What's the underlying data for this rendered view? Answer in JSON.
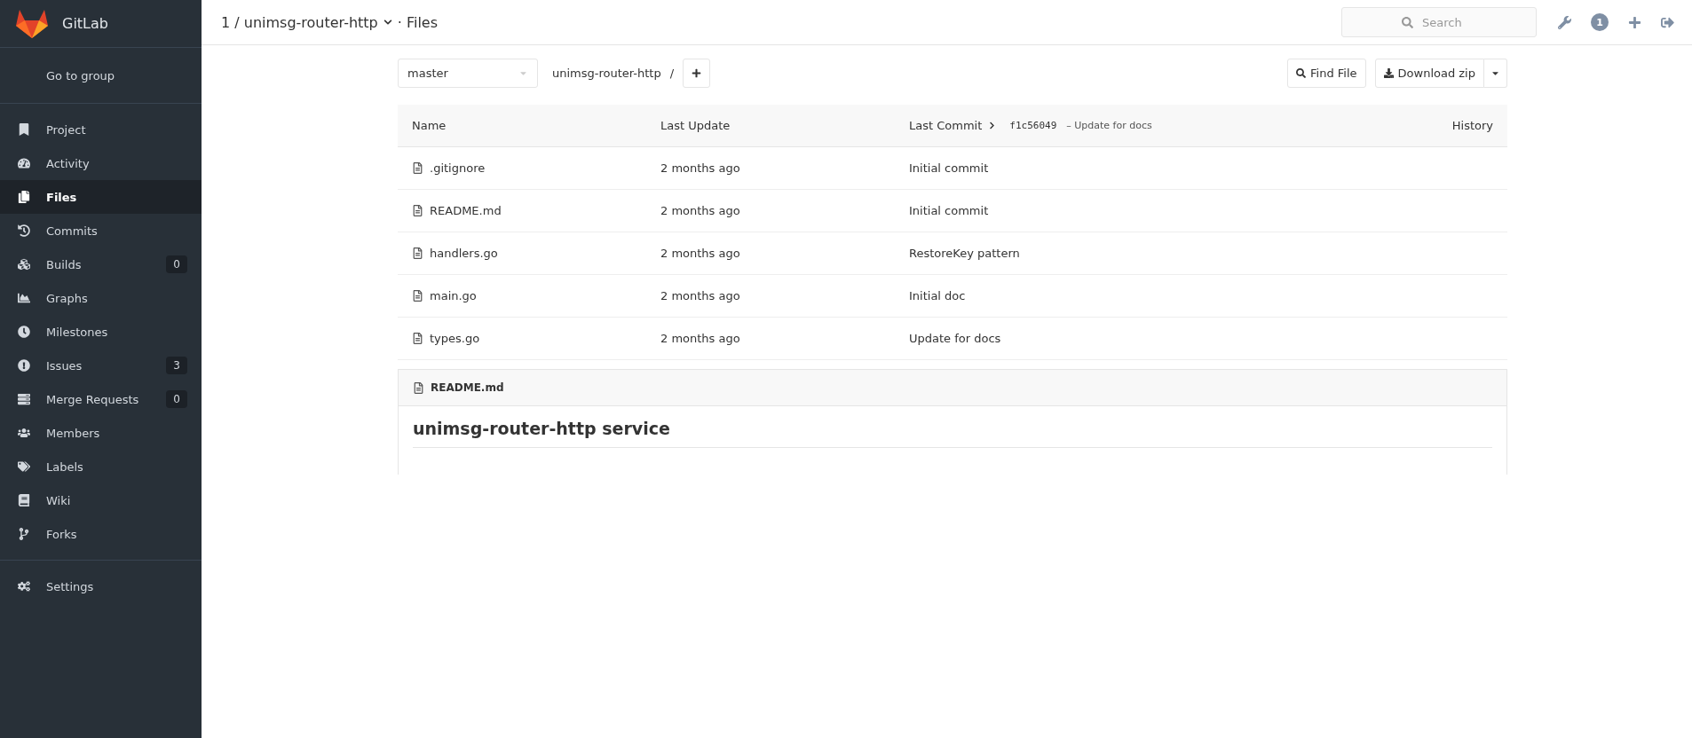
{
  "sidebar": {
    "brand": "GitLab",
    "group_link": "Go to group",
    "items": [
      {
        "label": "Project",
        "selected": false
      },
      {
        "label": "Activity",
        "selected": false
      },
      {
        "label": "Files",
        "selected": true
      },
      {
        "label": "Commits",
        "selected": false
      },
      {
        "label": "Builds",
        "selected": false,
        "badge": "0"
      },
      {
        "label": "Graphs",
        "selected": false
      },
      {
        "label": "Milestones",
        "selected": false
      },
      {
        "label": "Issues",
        "selected": false,
        "badge": "3"
      },
      {
        "label": "Merge Requests",
        "selected": false,
        "badge": "0"
      },
      {
        "label": "Members",
        "selected": false
      },
      {
        "label": "Labels",
        "selected": false
      },
      {
        "label": "Wiki",
        "selected": false
      },
      {
        "label": "Forks",
        "selected": false
      }
    ],
    "settings": "Settings"
  },
  "header": {
    "title": "1 / unimsg-router-http",
    "title_suffix": "· Files",
    "search": {
      "placeholder": "Search"
    },
    "notification_count": "1"
  },
  "toolbar": {
    "branch": "master",
    "path": "unimsg-router-http",
    "path_separator": "/",
    "find_file": "Find File",
    "download": "Download zip"
  },
  "table": {
    "columns": [
      "Name",
      "Last Update",
      "Last Commit"
    ],
    "commit_hash": "f1c56049",
    "commit_message": "– Update for docs",
    "history": "History",
    "rows": [
      {
        "name": ".gitignore",
        "updated": "2 months ago",
        "commit": "Initial commit"
      },
      {
        "name": "README.md",
        "updated": "2 months ago",
        "commit": "Initial commit"
      },
      {
        "name": "handlers.go",
        "updated": "2 months ago",
        "commit": "RestoreKey pattern"
      },
      {
        "name": "main.go",
        "updated": "2 months ago",
        "commit": "Initial doc"
      },
      {
        "name": "types.go",
        "updated": "2 months ago",
        "commit": "Update for docs"
      }
    ]
  },
  "readme": {
    "filename": "README.md",
    "heading": "unimsg-router-http service"
  }
}
